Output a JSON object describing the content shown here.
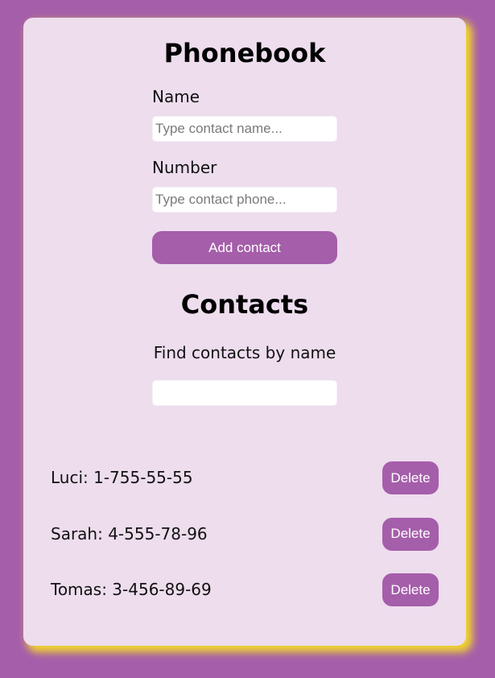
{
  "colors": {
    "page_background": "#a55eaa",
    "card_background": "#eddded",
    "card_shadow": "#f2d62c",
    "button_background": "#a55eaa",
    "button_text": "#ffffff"
  },
  "phonebook": {
    "title": "Phonebook",
    "name_label": "Name",
    "name_value": "",
    "name_placeholder": "Type contact name...",
    "number_label": "Number",
    "number_value": "",
    "number_placeholder": "Type contact phone...",
    "add_button_label": "Add contact"
  },
  "contacts": {
    "title": "Contacts",
    "filter_label": "Find contacts by name",
    "filter_value": "",
    "delete_label": "Delete",
    "items": [
      {
        "text": "Luci: 1-755-55-55"
      },
      {
        "text": "Sarah: 4-555-78-96"
      },
      {
        "text": "Tomas: 3-456-89-69"
      }
    ]
  }
}
